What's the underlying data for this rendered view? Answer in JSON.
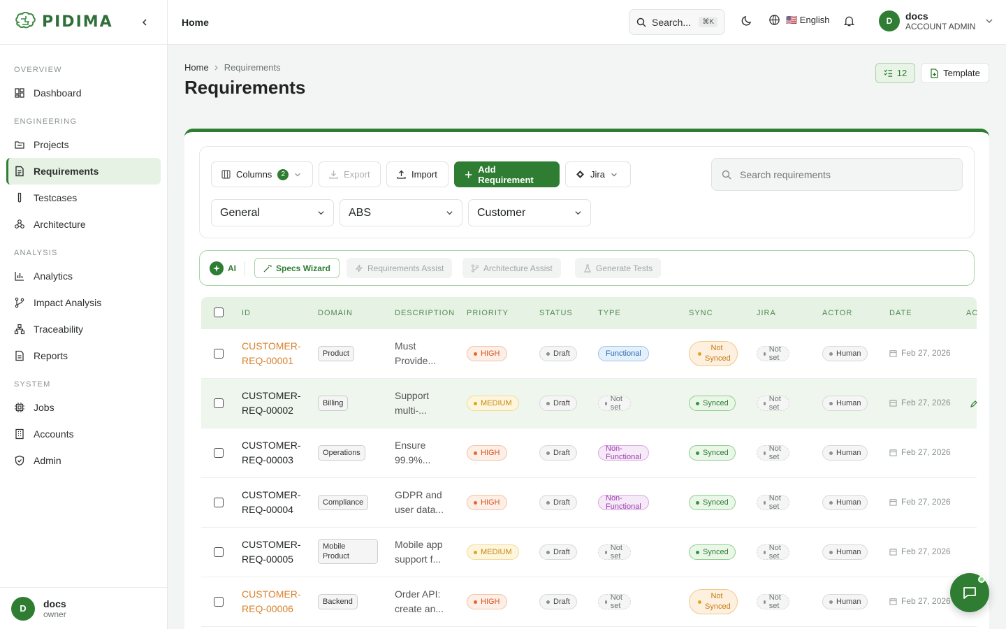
{
  "brand": {
    "name": "PIDIMA"
  },
  "sidebar": {
    "sections": [
      {
        "title": "OVERVIEW",
        "items": [
          {
            "label": "Dashboard",
            "icon": "dashboard-icon"
          }
        ]
      },
      {
        "title": "ENGINEERING",
        "items": [
          {
            "label": "Projects",
            "icon": "folder-icon"
          },
          {
            "label": "Requirements",
            "icon": "document-icon",
            "active": true
          },
          {
            "label": "Testcases",
            "icon": "test-tube-icon"
          },
          {
            "label": "Architecture",
            "icon": "architecture-icon"
          }
        ]
      },
      {
        "title": "ANALYSIS",
        "items": [
          {
            "label": "Analytics",
            "icon": "bar-chart-icon"
          },
          {
            "label": "Impact Analysis",
            "icon": "branch-icon"
          },
          {
            "label": "Traceability",
            "icon": "network-icon"
          },
          {
            "label": "Reports",
            "icon": "report-icon"
          }
        ]
      },
      {
        "title": "SYSTEM",
        "items": [
          {
            "label": "Jobs",
            "icon": "cpu-icon"
          },
          {
            "label": "Accounts",
            "icon": "building-icon"
          },
          {
            "label": "Admin",
            "icon": "shield-icon"
          }
        ]
      }
    ],
    "user": {
      "initial": "D",
      "name": "docs",
      "role": "owner"
    }
  },
  "header": {
    "title": "Home",
    "search": {
      "label": "Search...",
      "shortcut": "⌘K"
    },
    "language": "🇺🇸 English",
    "user": {
      "initial": "D",
      "name": "docs",
      "role": "ACCOUNT ADMIN"
    }
  },
  "page": {
    "breadcrumb": [
      "Home",
      "Requirements"
    ],
    "title": "Requirements",
    "count": "12",
    "template_label": "Template"
  },
  "toolbar": {
    "columns_label": "Columns",
    "columns_count": "2",
    "export_label": "Export",
    "import_label": "Import",
    "add_label": "Add Requirement",
    "jira_label": "Jira",
    "search_placeholder": "Search requirements",
    "filters": [
      "General",
      "ABS",
      "Customer"
    ]
  },
  "ai_bar": {
    "label": "AI",
    "buttons": [
      "Specs Wizard",
      "Requirements Assist",
      "Architecture Assist",
      "Generate Tests"
    ]
  },
  "table": {
    "headers": [
      "ID",
      "DOMAIN",
      "DESCRIPTION",
      "PRIORITY",
      "STATUS",
      "TYPE",
      "SYNC",
      "JIRA",
      "ACTOR",
      "DATE",
      "AC"
    ],
    "rows": [
      {
        "id": "CUSTOMER-REQ-00001",
        "id_lines": [
          "CUSTOMER-",
          "REQ-00001"
        ],
        "id_warn": true,
        "domain": "Product",
        "desc_lines": [
          "Must",
          "Provide..."
        ],
        "priority": "HIGH",
        "status": "Draft",
        "type": "Functional",
        "sync": "Not Synced",
        "jira": "Not set",
        "actor": "Human",
        "date": "Feb 27, 2026"
      },
      {
        "id": "CUSTOMER-REQ-00002",
        "id_lines": [
          "CUSTOMER-",
          "REQ-00002"
        ],
        "id_warn": false,
        "domain": "Billing",
        "desc_lines": [
          "Support",
          "multi-..."
        ],
        "priority": "MEDIUM",
        "status": "Draft",
        "type": "Not set",
        "sync": "Synced",
        "jira": "Not set",
        "actor": "Human",
        "date": "Feb 27, 2026"
      },
      {
        "id": "CUSTOMER-REQ-00003",
        "id_lines": [
          "CUSTOMER-",
          "REQ-00003"
        ],
        "id_warn": false,
        "domain": "Operations",
        "desc_lines": [
          "Ensure",
          "99.9%..."
        ],
        "priority": "HIGH",
        "status": "Draft",
        "type": "Non-Functional",
        "sync": "Synced",
        "jira": "Not set",
        "actor": "Human",
        "date": "Feb 27, 2026"
      },
      {
        "id": "CUSTOMER-REQ-00004",
        "id_lines": [
          "CUSTOMER-",
          "REQ-00004"
        ],
        "id_warn": false,
        "domain": "Compliance",
        "desc_lines": [
          "GDPR and",
          "user data..."
        ],
        "priority": "HIGH",
        "status": "Draft",
        "type": "Non-Functional",
        "sync": "Synced",
        "jira": "Not set",
        "actor": "Human",
        "date": "Feb 27, 2026"
      },
      {
        "id": "CUSTOMER-REQ-00005",
        "id_lines": [
          "CUSTOMER-",
          "REQ-00005"
        ],
        "id_warn": false,
        "domain": "Mobile Product",
        "desc_lines": [
          "Mobile app",
          "support f..."
        ],
        "priority": "MEDIUM",
        "status": "Draft",
        "type": "Not set",
        "sync": "Synced",
        "jira": "Not set",
        "actor": "Human",
        "date": "Feb 27, 2026"
      },
      {
        "id": "CUSTOMER-REQ-00006",
        "id_lines": [
          "CUSTOMER-",
          "REQ-00006"
        ],
        "id_warn": true,
        "domain": "Backend",
        "desc_lines": [
          "Order API:",
          "create an..."
        ],
        "priority": "HIGH",
        "status": "Draft",
        "type": "Not set",
        "sync": "Not Synced",
        "jira": "Not set",
        "actor": "Human",
        "date": "Feb 27, 2026"
      }
    ]
  },
  "colors": {
    "accent": "#2f7d32",
    "warn": "#d9822b"
  }
}
